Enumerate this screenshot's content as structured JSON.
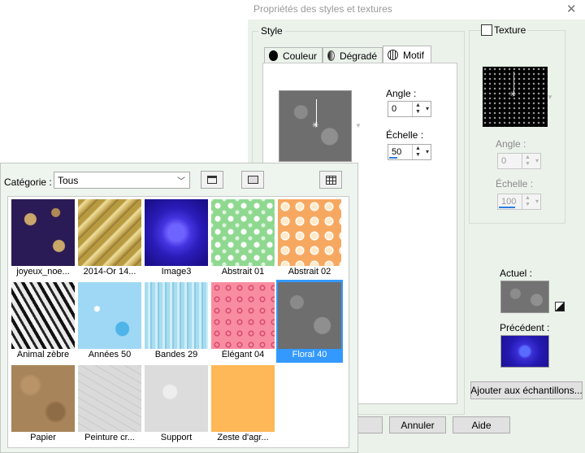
{
  "dialog": {
    "title": "Propriétés des styles et textures",
    "close_glyph": "✕",
    "style_group": "Style",
    "tabs": [
      {
        "label": "Couleur",
        "icon": "black-circle-icon"
      },
      {
        "label": "Dégradé",
        "icon": "gradient-circle-icon"
      },
      {
        "label": "Motif",
        "icon": "globe-pattern-icon"
      }
    ],
    "angle_label": "Angle :",
    "angle_value": "0",
    "scale_label": "Échelle :",
    "scale_value": "50",
    "texture": {
      "checkbox_label": "Texture",
      "checked": false,
      "angle_label": "Angle :",
      "angle_value": "0",
      "scale_label": "Échelle :",
      "scale_value": "100"
    },
    "current_label": "Actuel :",
    "previous_label": "Précédent :",
    "add_swatches_button": "Ajouter aux échantillons...",
    "cancel_button": "Annuler",
    "help_button": "Aide"
  },
  "picker": {
    "category_label": "Catégorie :",
    "category_value": "Tous",
    "patterns": [
      {
        "label": "joyeux_noe...",
        "icon": "christmas-pattern"
      },
      {
        "label": "2014-Or 14...",
        "icon": "gold-stripes-pattern"
      },
      {
        "label": "Image3",
        "icon": "blue-radial-pattern"
      },
      {
        "label": "Abstrait 01",
        "icon": "green-dots-pattern"
      },
      {
        "label": "Abstrait 02",
        "icon": "orange-dots-pattern"
      },
      {
        "label": "Animal zèbre",
        "icon": "zebra-pattern"
      },
      {
        "label": "Années 50",
        "icon": "retro-blue-pattern"
      },
      {
        "label": "Bandes 29",
        "icon": "blue-stripes-pattern"
      },
      {
        "label": "Élégant 04",
        "icon": "pink-swirl-pattern"
      },
      {
        "label": "Floral 40",
        "icon": "grey-floral-pattern",
        "selected": true
      },
      {
        "label": "Papier",
        "icon": "paper-pattern"
      },
      {
        "label": "Peinture cr...",
        "icon": "crackle-paint-pattern"
      },
      {
        "label": "Support",
        "icon": "support-pattern"
      },
      {
        "label": "Zeste d'agr...",
        "icon": "citrus-pattern"
      }
    ]
  }
}
